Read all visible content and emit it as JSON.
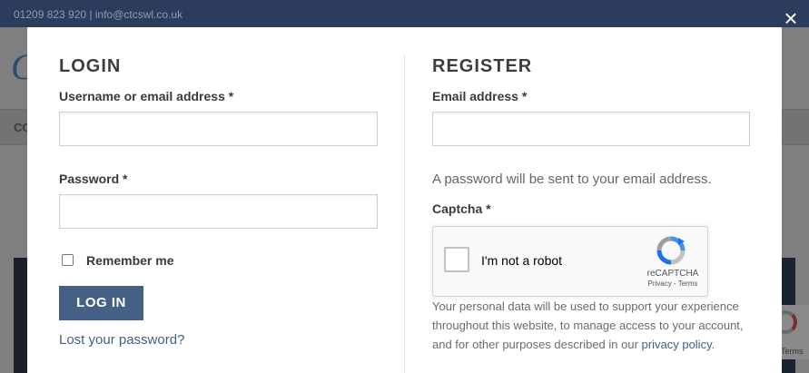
{
  "topbar": {
    "contact": "01209 823 920 | info@ctcswl.co.uk"
  },
  "navbar": {
    "first_item": "CO"
  },
  "background": {
    "logo_letter": "C"
  },
  "modal": {
    "close_icon": "×",
    "login": {
      "title": "LOGIN",
      "username_label": "Username or email address *",
      "username_value": "",
      "password_label": "Password *",
      "password_value": "",
      "remember_label": "Remember me",
      "remember_checked": false,
      "button_label": "LOG IN",
      "lost_password": "Lost your password?"
    },
    "register": {
      "title": "REGISTER",
      "email_label": "Email address *",
      "email_value": "",
      "password_note": "A password will be sent to your email address.",
      "captcha_label": "Captcha *",
      "recaptcha": {
        "checkbox_text": "I'm not a robot",
        "brand": "reCAPTCHA",
        "terms": "Privacy - Terms"
      },
      "privacy_text": "Your personal data will be used to support your experience throughout this website, to manage access to your account, and for other purposes described in our",
      "privacy_link": "privacy policy",
      "privacy_end": "."
    }
  },
  "badge": {
    "terms": "Terms"
  },
  "colors": {
    "topbar": "#2b3c5c",
    "primary_button": "#446084",
    "link": "#446084",
    "overlay": "#7f7f7f"
  }
}
